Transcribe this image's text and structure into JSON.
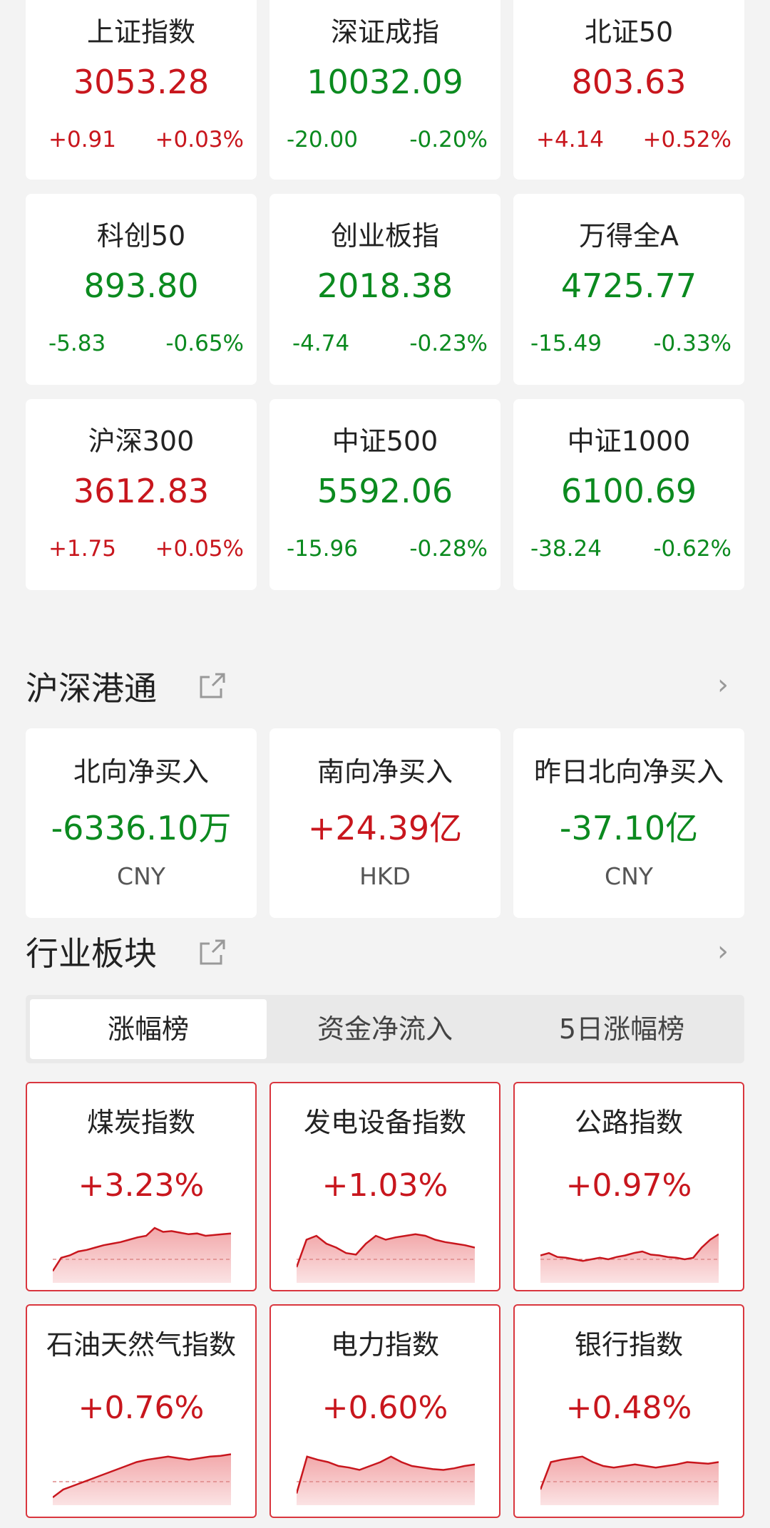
{
  "indices": [
    {
      "name": "上证指数",
      "value": "3053.28",
      "change": "+0.91",
      "pct": "+0.03%",
      "trend": "up"
    },
    {
      "name": "深证成指",
      "value": "10032.09",
      "change": "-20.00",
      "pct": "-0.20%",
      "trend": "down"
    },
    {
      "name": "北证50",
      "value": "803.63",
      "change": "+4.14",
      "pct": "+0.52%",
      "trend": "up"
    },
    {
      "name": "科创50",
      "value": "893.80",
      "change": "-5.83",
      "pct": "-0.65%",
      "trend": "down"
    },
    {
      "name": "创业板指",
      "value": "2018.38",
      "change": "-4.74",
      "pct": "-0.23%",
      "trend": "down"
    },
    {
      "name": "万得全A",
      "value": "4725.77",
      "change": "-15.49",
      "pct": "-0.33%",
      "trend": "down"
    },
    {
      "name": "沪深300",
      "value": "3612.83",
      "change": "+1.75",
      "pct": "+0.05%",
      "trend": "up"
    },
    {
      "name": "中证500",
      "value": "5592.06",
      "change": "-15.96",
      "pct": "-0.28%",
      "trend": "down"
    },
    {
      "name": "中证1000",
      "value": "6100.69",
      "change": "-38.24",
      "pct": "-0.62%",
      "trend": "down"
    }
  ],
  "connect": {
    "title": "沪深港通",
    "items": [
      {
        "name": "北向净买入",
        "value": "-6336.10万",
        "currency": "CNY",
        "trend": "down"
      },
      {
        "name": "南向净买入",
        "value": "+24.39亿",
        "currency": "HKD",
        "trend": "up"
      },
      {
        "name": "昨日北向净买入",
        "value": "-37.10亿",
        "currency": "CNY",
        "trend": "down"
      }
    ]
  },
  "sector": {
    "title": "行业板块",
    "tabs": [
      "涨幅榜",
      "资金净流入",
      "5日涨幅榜"
    ],
    "active_tab": 0,
    "items": [
      {
        "name": "煤炭指数",
        "pct": "+3.23%",
        "spark": [
          0.15,
          0.32,
          0.35,
          0.4,
          0.42,
          0.45,
          0.48,
          0.5,
          0.52,
          0.55,
          0.58,
          0.6,
          0.7,
          0.65,
          0.66,
          0.64,
          0.62,
          0.63,
          0.6,
          0.61,
          0.62,
          0.63
        ]
      },
      {
        "name": "发电设备指数",
        "pct": "+1.03%",
        "spark": [
          0.2,
          0.55,
          0.6,
          0.5,
          0.45,
          0.38,
          0.36,
          0.5,
          0.6,
          0.55,
          0.58,
          0.6,
          0.62,
          0.6,
          0.55,
          0.52,
          0.5,
          0.48,
          0.45
        ]
      },
      {
        "name": "公路指数",
        "pct": "+0.97%",
        "spark": [
          0.35,
          0.38,
          0.33,
          0.32,
          0.3,
          0.28,
          0.3,
          0.32,
          0.3,
          0.33,
          0.35,
          0.38,
          0.4,
          0.36,
          0.35,
          0.33,
          0.32,
          0.3,
          0.32,
          0.45,
          0.55,
          0.62
        ]
      },
      {
        "name": "石油天然气指数",
        "pct": "+0.76%",
        "spark": [
          0.1,
          0.2,
          0.25,
          0.3,
          0.35,
          0.4,
          0.45,
          0.5,
          0.55,
          0.58,
          0.6,
          0.62,
          0.6,
          0.58,
          0.6,
          0.62,
          0.63,
          0.65
        ]
      },
      {
        "name": "电力指数",
        "pct": "+0.60%",
        "spark": [
          0.15,
          0.62,
          0.58,
          0.55,
          0.5,
          0.48,
          0.45,
          0.5,
          0.55,
          0.62,
          0.55,
          0.5,
          0.48,
          0.46,
          0.45,
          0.47,
          0.5,
          0.52
        ]
      },
      {
        "name": "银行指数",
        "pct": "+0.48%",
        "spark": [
          0.2,
          0.55,
          0.58,
          0.6,
          0.62,
          0.55,
          0.5,
          0.48,
          0.5,
          0.52,
          0.5,
          0.48,
          0.5,
          0.52,
          0.55,
          0.54,
          0.53,
          0.55
        ]
      }
    ]
  },
  "colors": {
    "up": "#c8161d",
    "down": "#0b8a1f"
  }
}
